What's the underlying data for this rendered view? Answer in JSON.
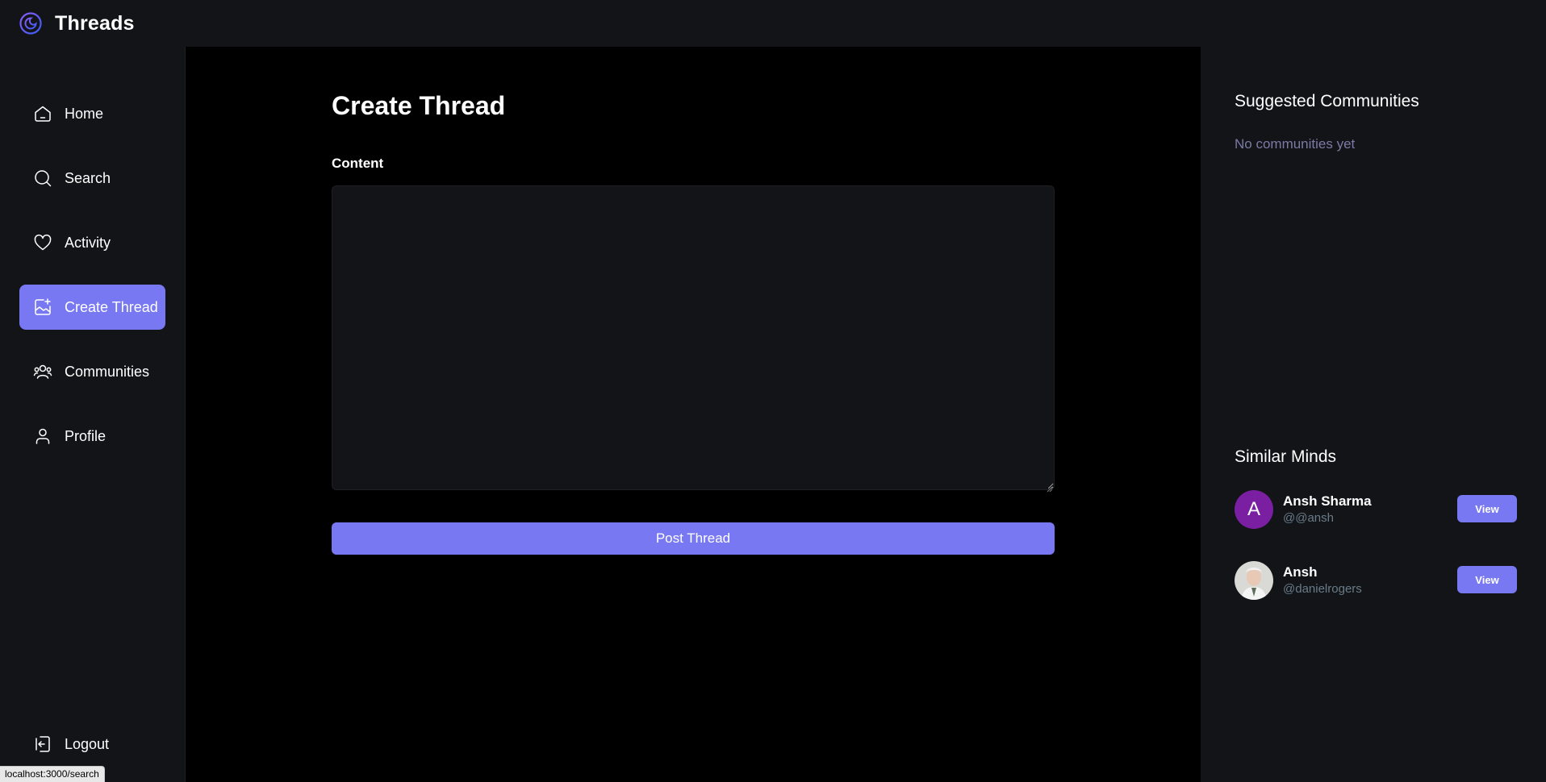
{
  "app": {
    "name": "Threads",
    "logo_icon": "threads-logo-icon"
  },
  "colors": {
    "accent": "#7878f3",
    "surface": "#121417",
    "background": "#000000",
    "muted_text": "#7b7aa6",
    "handle_text": "#697c89"
  },
  "sidebar": {
    "items": [
      {
        "label": "Home",
        "icon": "home-icon",
        "active": false
      },
      {
        "label": "Search",
        "icon": "search-icon",
        "active": false
      },
      {
        "label": "Activity",
        "icon": "heart-icon",
        "active": false
      },
      {
        "label": "Create Thread",
        "icon": "create-image-icon",
        "active": true
      },
      {
        "label": "Communities",
        "icon": "users-icon",
        "active": false
      },
      {
        "label": "Profile",
        "icon": "user-icon",
        "active": false
      }
    ],
    "logout": {
      "label": "Logout",
      "icon": "logout-icon"
    }
  },
  "main": {
    "title": "Create Thread",
    "content_label": "Content",
    "content_value": "",
    "post_button": "Post Thread"
  },
  "right": {
    "suggested_title": "Suggested Communities",
    "suggested_empty": "No communities yet",
    "similar_title": "Similar Minds",
    "users": [
      {
        "avatar_letter": "A",
        "name": "Ansh Sharma",
        "handle": "@@ansh",
        "button": "View"
      },
      {
        "avatar_letter": "",
        "name": "Ansh",
        "handle": "@danielrogers",
        "button": "View"
      }
    ]
  },
  "status_bar": {
    "url": "localhost:3000/search"
  }
}
